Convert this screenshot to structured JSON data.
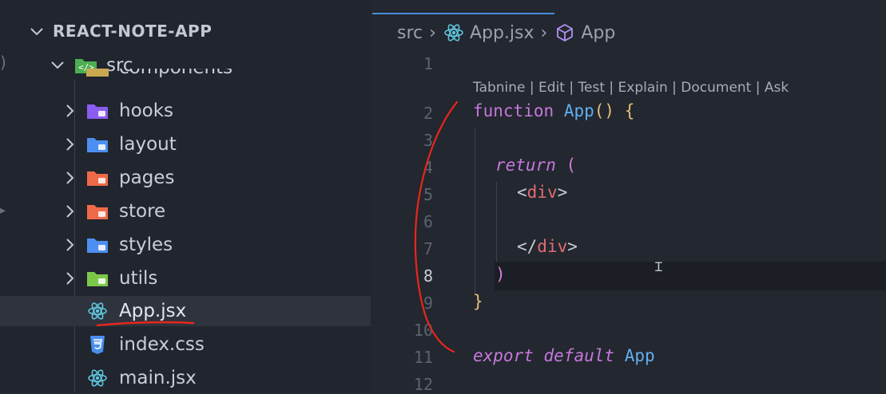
{
  "explorer": {
    "project_title": "REACT-NOTE-APP",
    "src_folder": "src",
    "partial_folder": "components",
    "folders": [
      {
        "label": "hooks",
        "icon": "hooks-folder-icon",
        "color": "#8a5cf0"
      },
      {
        "label": "layout",
        "icon": "layout-folder-icon",
        "color": "#4d8ff0"
      },
      {
        "label": "pages",
        "icon": "pages-folder-icon",
        "color": "#f06a4a"
      },
      {
        "label": "store",
        "icon": "store-folder-icon",
        "color": "#f06a4a"
      },
      {
        "label": "styles",
        "icon": "styles-folder-icon",
        "color": "#4d8ff0"
      },
      {
        "label": "utils",
        "icon": "utils-folder-icon",
        "color": "#7cc94a"
      }
    ],
    "files": [
      {
        "label": "App.jsx",
        "icon": "react-icon",
        "selected": true
      },
      {
        "label": "index.css",
        "icon": "css-icon",
        "selected": false
      },
      {
        "label": "main.jsx",
        "icon": "react-icon",
        "selected": false
      }
    ]
  },
  "editor": {
    "breadcrumb": [
      "src",
      "App.jsx",
      "App"
    ],
    "codelens": "Tabnine | Edit | Test | Explain | Document | Ask",
    "line_numbers": [
      "1",
      "2",
      "3",
      "4",
      "5",
      "6",
      "7",
      "8",
      "9",
      "10",
      "11",
      "12"
    ],
    "active_line": "8",
    "code": {
      "l2_keyword": "function",
      "l2_name": "App",
      "l2_parens": "()",
      "l2_brace": "{",
      "l4_keyword": "return",
      "l4_paren": "(",
      "l5_open_lt": "<",
      "l5_tag": "div",
      "l5_open_gt": ">",
      "l7_close_lt": "</",
      "l7_tag": "div",
      "l7_close_gt": ">",
      "l8_paren": ")",
      "l9_brace": "}",
      "l11_export": "export",
      "l11_default": "default",
      "l11_name": "App"
    }
  },
  "colors": {
    "accent": "#4a8fd8",
    "annotation_red": "#e8261c",
    "react_cyan": "#5ec5dc"
  }
}
